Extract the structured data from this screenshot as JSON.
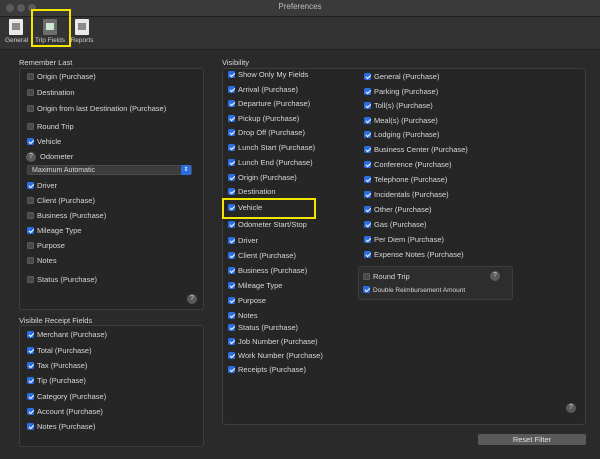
{
  "window": {
    "title": "Preferences"
  },
  "toolbar": {
    "items": [
      {
        "label": "General"
      },
      {
        "label": "Trip Fields"
      },
      {
        "label": "Reports"
      }
    ]
  },
  "remember": {
    "title": "Remember Last",
    "items": [
      {
        "label": "Origin (Purchase)",
        "checked": false
      },
      {
        "label": "Destination",
        "checked": false
      },
      {
        "label": "Origin from last Destination (Purchase)",
        "checked": false
      },
      {
        "label": "Round Trip",
        "checked": false
      },
      {
        "label": "Vehicle",
        "checked": true
      },
      {
        "label": "Odometer"
      },
      {
        "label": "Driver",
        "checked": true
      },
      {
        "label": "Client (Purchase)",
        "checked": false
      },
      {
        "label": "Business (Purchase)",
        "checked": false
      },
      {
        "label": "Mileage Type",
        "checked": true
      },
      {
        "label": "Purpose",
        "checked": false
      },
      {
        "label": "Notes",
        "checked": false
      },
      {
        "label": "Status (Purchase)",
        "checked": false
      }
    ],
    "odometer_select": "Maximum Automatic"
  },
  "receipt": {
    "title": "Visibile Receipt Fields",
    "items": [
      {
        "label": "Merchant (Purchase)",
        "checked": true
      },
      {
        "label": "Total (Purchase)",
        "checked": true
      },
      {
        "label": "Tax (Purchase)",
        "checked": true
      },
      {
        "label": "Tip (Purchase)",
        "checked": true
      },
      {
        "label": "Category (Purchase)",
        "checked": true
      },
      {
        "label": "Account (Purchase)",
        "checked": true
      },
      {
        "label": "Notes (Purchase)",
        "checked": true
      }
    ]
  },
  "visibility": {
    "title": "Visibility",
    "col1": [
      {
        "label": "Show Only My Fields",
        "checked": true
      },
      {
        "label": "Arrival (Purchase)",
        "checked": true
      },
      {
        "label": "Departure (Purchase)",
        "checked": true
      },
      {
        "label": "Pickup (Purchase)",
        "checked": true
      },
      {
        "label": "Drop Off (Purchase)",
        "checked": true
      },
      {
        "label": "Lunch Start (Purchase)",
        "checked": true
      },
      {
        "label": "Lunch End (Purchase)",
        "checked": true
      },
      {
        "label": "Origin (Purchase)",
        "checked": true
      },
      {
        "label": "Destination",
        "checked": true
      },
      {
        "label": "Vehicle",
        "checked": true
      },
      {
        "label": "Odometer Start/Stop",
        "checked": true
      },
      {
        "label": "Driver",
        "checked": true
      },
      {
        "label": "Client (Purchase)",
        "checked": true
      },
      {
        "label": "Business (Purchase)",
        "checked": true
      },
      {
        "label": "Mileage Type",
        "checked": true
      },
      {
        "label": "Purpose",
        "checked": true
      },
      {
        "label": "Notes",
        "checked": true
      },
      {
        "label": "Status (Purchase)",
        "checked": true
      },
      {
        "label": "Job Number (Purchase)",
        "checked": true
      },
      {
        "label": "Work Number (Purchase)",
        "checked": true
      },
      {
        "label": "Receipts (Purchase)",
        "checked": true
      }
    ],
    "col2": [
      {
        "label": "General (Purchase)",
        "checked": true
      },
      {
        "label": "Parking (Purchase)",
        "checked": true
      },
      {
        "label": "Toll(s) (Purchase)",
        "checked": true
      },
      {
        "label": "Meal(s) (Purchase)",
        "checked": true
      },
      {
        "label": "Lodging (Purchase)",
        "checked": true
      },
      {
        "label": "Business Center (Purchase)",
        "checked": true
      },
      {
        "label": "Conference (Purchase)",
        "checked": true
      },
      {
        "label": "Telephone (Purchase)",
        "checked": true
      },
      {
        "label": "Incidentals (Purchase)",
        "checked": true
      },
      {
        "label": "Other (Purchase)",
        "checked": true
      },
      {
        "label": "Gas (Purchase)",
        "checked": true
      },
      {
        "label": "Per Diem (Purchase)",
        "checked": true
      },
      {
        "label": "Expense Notes (Purchase)",
        "checked": true
      }
    ],
    "roundtrip": [
      {
        "label": "Round Trip",
        "checked": false
      },
      {
        "label": "Double Reimbursement Amount",
        "checked": true
      }
    ]
  },
  "help_glyph": "?",
  "reset_label": "Reset Filter",
  "colors": {
    "accent": "#2a6de0",
    "highlight": "#f2e600"
  }
}
